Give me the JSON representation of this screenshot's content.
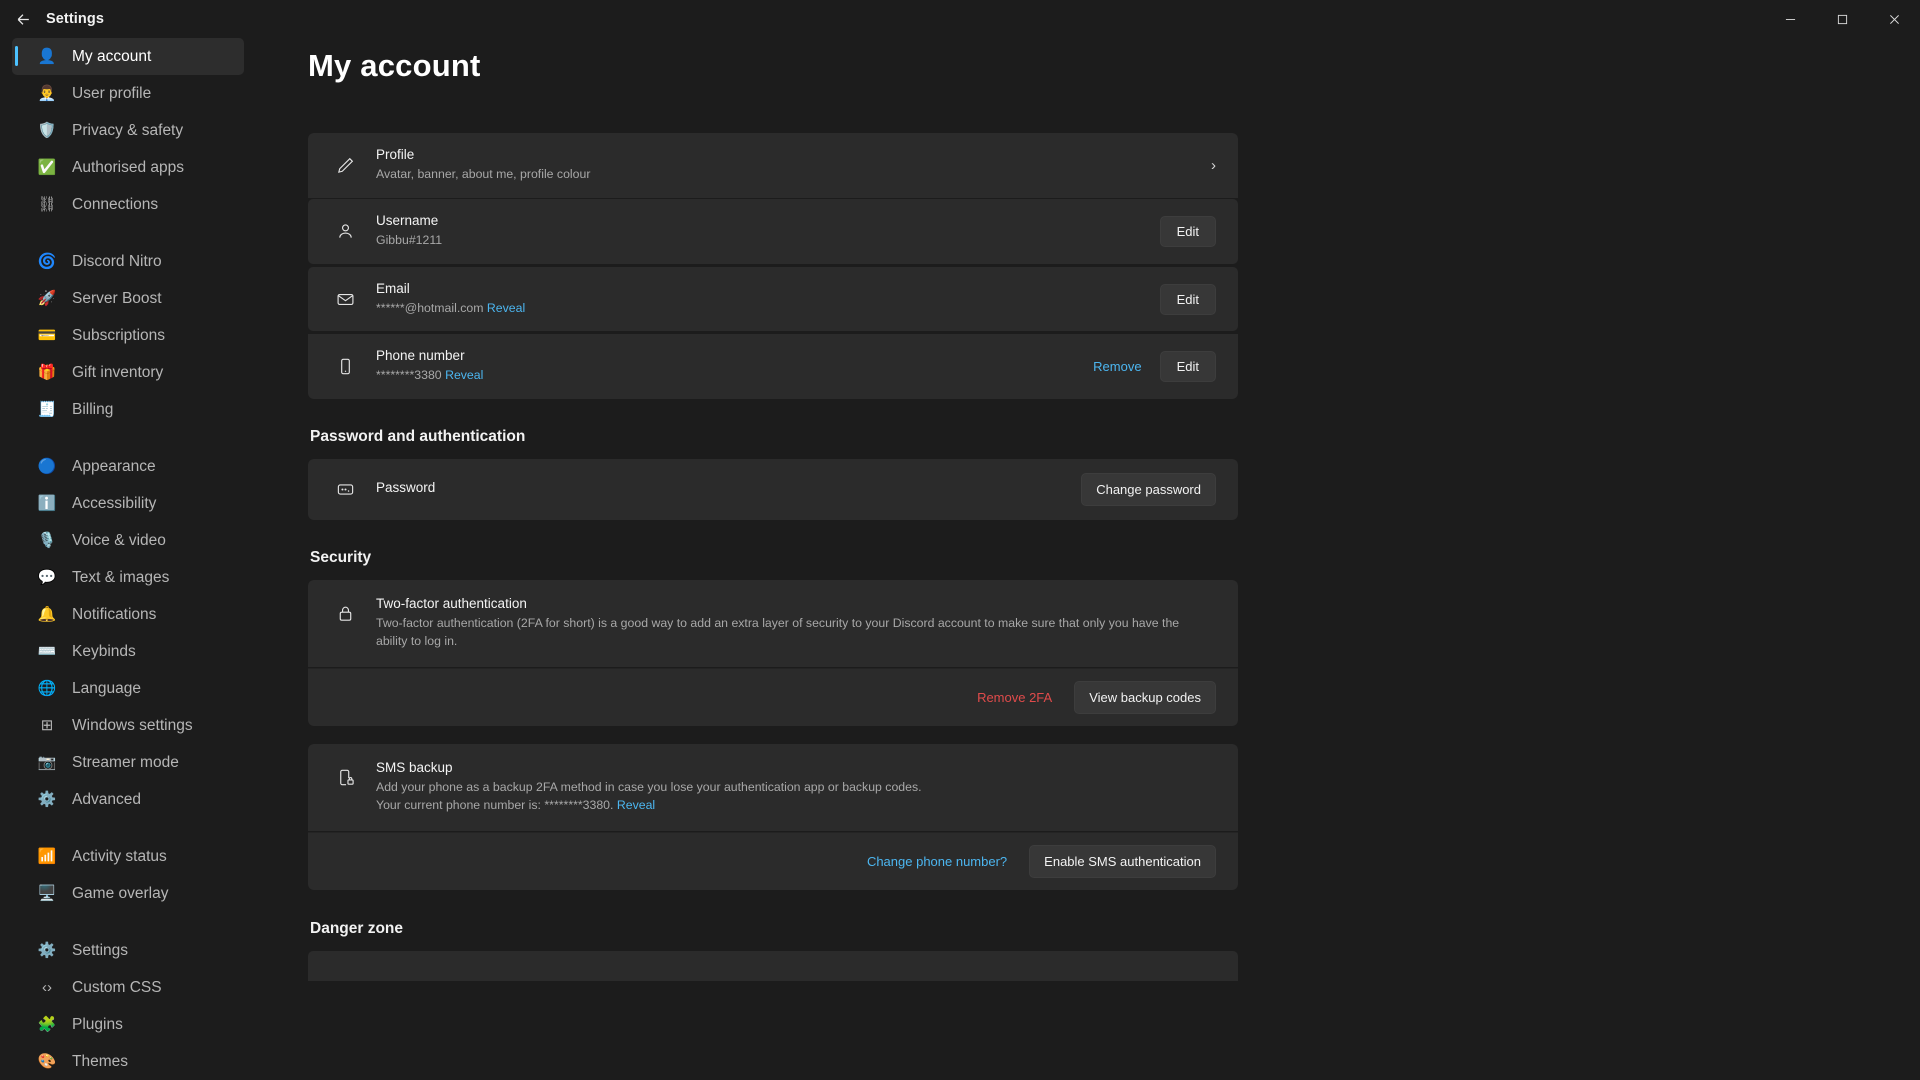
{
  "window": {
    "title": "Settings",
    "back_icon": "arrow-left-icon",
    "minimize_label": "Minimise",
    "maximize_label": "Maximise",
    "close_label": "Close"
  },
  "sidebar": {
    "groups": [
      {
        "items": [
          {
            "label": "My account",
            "icon": "person-blue-emoji",
            "glyph": "👤",
            "active": true
          },
          {
            "label": "User profile",
            "icon": "user-profile-emoji",
            "glyph": "👨‍💼",
            "active": false
          },
          {
            "label": "Privacy & safety",
            "icon": "shield-emoji",
            "glyph": "🛡️",
            "active": false
          },
          {
            "label": "Authorised apps",
            "icon": "check-circle-emoji",
            "glyph": "✅",
            "active": false
          },
          {
            "label": "Connections",
            "icon": "connections-share-icon",
            "glyph": "⛓",
            "active": false
          }
        ]
      },
      {
        "items": [
          {
            "label": "Discord Nitro",
            "icon": "nitro-emoji",
            "glyph": "🌀",
            "active": false
          },
          {
            "label": "Server Boost",
            "icon": "rocket-emoji",
            "glyph": "🚀",
            "active": false
          },
          {
            "label": "Subscriptions",
            "icon": "credit-card-emoji",
            "glyph": "💳",
            "active": false
          },
          {
            "label": "Gift inventory",
            "icon": "gift-emoji",
            "glyph": "🎁",
            "active": false
          },
          {
            "label": "Billing",
            "icon": "billing-emoji",
            "glyph": "🧾",
            "active": false
          }
        ]
      },
      {
        "items": [
          {
            "label": "Appearance",
            "icon": "appearance-eye-emoji",
            "glyph": "🔵",
            "active": false
          },
          {
            "label": "Accessibility",
            "icon": "accessibility-emoji",
            "glyph": "ℹ️",
            "active": false
          },
          {
            "label": "Voice & video",
            "icon": "microphone-emoji",
            "glyph": "🎙️",
            "active": false
          },
          {
            "label": "Text & images",
            "icon": "text-images-emoji",
            "glyph": "💬",
            "active": false
          },
          {
            "label": "Notifications",
            "icon": "bell-emoji",
            "glyph": "🔔",
            "active": false
          },
          {
            "label": "Keybinds",
            "icon": "keyboard-key-emoji",
            "glyph": "⌨️",
            "active": false
          },
          {
            "label": "Language",
            "icon": "language-translate-emoji",
            "glyph": "🌐",
            "active": false
          },
          {
            "label": "Windows settings",
            "icon": "windows-logo-icon",
            "glyph": "⊞",
            "active": false
          },
          {
            "label": "Streamer mode",
            "icon": "camera-emoji",
            "glyph": "📷",
            "active": false
          },
          {
            "label": "Advanced",
            "icon": "gears-emoji",
            "glyph": "⚙️",
            "active": false
          }
        ]
      },
      {
        "items": [
          {
            "label": "Activity status",
            "icon": "wifi-emoji",
            "glyph": "📶",
            "active": false
          },
          {
            "label": "Game overlay",
            "icon": "monitor-emoji",
            "glyph": "🖥️",
            "active": false
          }
        ]
      },
      {
        "items": [
          {
            "label": "Settings",
            "icon": "gear-emoji",
            "glyph": "⚙️",
            "active": false
          },
          {
            "label": "Custom CSS",
            "icon": "code-brackets-icon",
            "glyph": "‹›",
            "active": false
          },
          {
            "label": "Plugins",
            "icon": "plugins-puzzle-emoji",
            "glyph": "🧩",
            "active": false
          },
          {
            "label": "Themes",
            "icon": "themes-palette-emoji",
            "glyph": "🎨",
            "active": false
          }
        ]
      }
    ]
  },
  "main": {
    "page_title": "My account",
    "account": {
      "profile": {
        "icon": "pencil-icon",
        "title": "Profile",
        "subtitle": "Avatar, banner, about me, profile colour",
        "chevron": "›"
      },
      "username": {
        "icon": "person-outline-icon",
        "title": "Username",
        "value": "Gibbu#1211",
        "edit_label": "Edit"
      },
      "email": {
        "icon": "envelope-icon",
        "title": "Email",
        "value": "******@hotmail.com",
        "reveal_label": "Reveal",
        "edit_label": "Edit"
      },
      "phone": {
        "icon": "phone-icon",
        "title": "Phone number",
        "value": "********3380",
        "reveal_label": "Reveal",
        "remove_label": "Remove",
        "edit_label": "Edit"
      }
    },
    "password_section": {
      "heading": "Password and authentication",
      "password": {
        "icon": "password-dots-icon",
        "title": "Password",
        "change_label": "Change password"
      }
    },
    "security_section": {
      "heading": "Security",
      "two_factor": {
        "icon": "lock-icon",
        "title": "Two-factor authentication",
        "description": "Two-factor authentication (2FA for short) is a good way to add an extra layer of security to your Discord account to make sure that only you have the ability to log in.",
        "remove_label": "Remove 2FA",
        "backup_codes_label": "View backup codes"
      },
      "sms_backup": {
        "icon": "phone-lock-icon",
        "title": "SMS backup",
        "description_line1": "Add your phone as a backup 2FA method in case you lose your authentication app or backup codes.",
        "description_line2_prefix": "Your current phone number is: ********3380.",
        "reveal_label": "Reveal",
        "change_phone_label": "Change phone number?",
        "enable_label": "Enable SMS authentication"
      }
    },
    "danger_zone": {
      "heading": "Danger zone"
    }
  },
  "colors": {
    "accent": "#4cb6f0",
    "danger": "#e04b4b",
    "card": "#2b2b2b",
    "background": "#1c1c1c",
    "active_indicator": "#4cc2ff"
  }
}
